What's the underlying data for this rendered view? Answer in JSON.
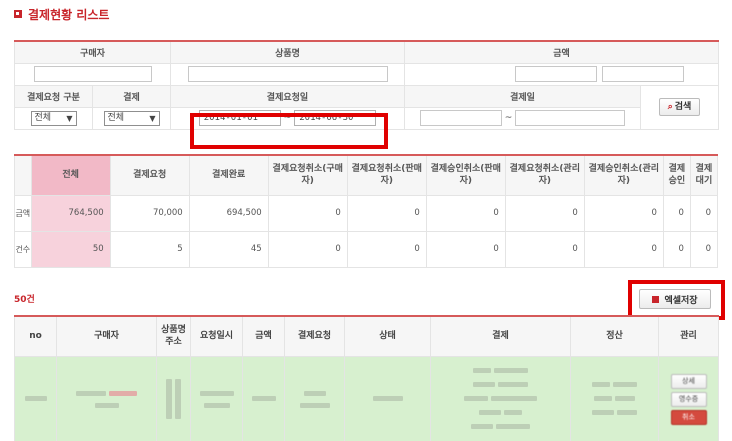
{
  "title": "결제현황 리스트",
  "filter": {
    "headers1": [
      "구매자",
      "상품명",
      "금액"
    ],
    "headers2": [
      "결제요청 구분",
      "결제",
      "결제요청일",
      "결제일"
    ],
    "request_type": "전체",
    "payment_type": "전체",
    "date_from": "2014-01-01",
    "date_to": "2014-06-30",
    "tilde": "~",
    "tilde2": "~",
    "search_label": "검색"
  },
  "stats": {
    "headers": [
      "전체",
      "결제요청",
      "결제완료",
      "결제요청취소(구매자)",
      "결제요청취소(판매자)",
      "결제승인취소(판매자)",
      "결제요청취소(관리자)",
      "결제승인취소(관리자)",
      "결제승인",
      "결제대기"
    ],
    "rows": [
      {
        "label": "금액",
        "values": [
          "764,500",
          "70,000",
          "694,500",
          "0",
          "0",
          "0",
          "0",
          "0",
          "0",
          "0"
        ]
      },
      {
        "label": "건수",
        "values": [
          "50",
          "5",
          "45",
          "0",
          "0",
          "0",
          "0",
          "0",
          "0",
          "0"
        ]
      }
    ]
  },
  "list": {
    "count": "50건",
    "excel_label": "엑셀저장",
    "headers": [
      "no",
      "구매자",
      "상품명 주소",
      "요청일시",
      "금액",
      "결제요청",
      "상태",
      "결제",
      "정산",
      "관리"
    ],
    "manage_buttons": [
      "상세",
      "영수증",
      "취소"
    ]
  },
  "colors": {
    "accent": "#c8252b",
    "highlight_box": "#e00000",
    "row_green": "#d7f0cf",
    "pink": "#f2b9c7"
  }
}
